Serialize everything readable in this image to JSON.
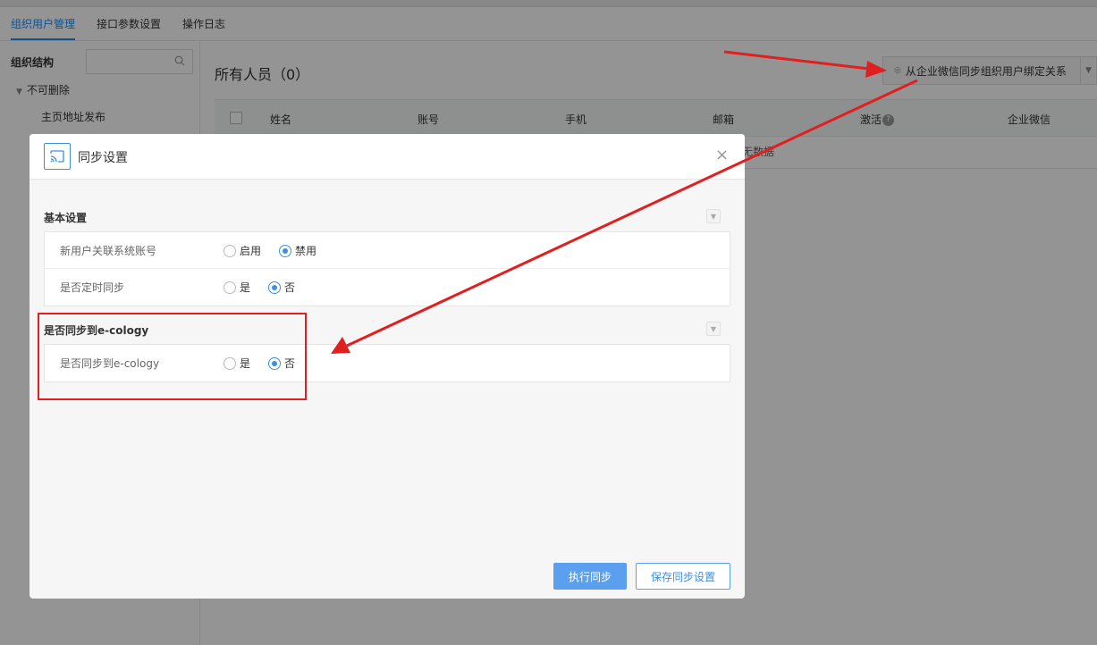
{
  "tabs": [
    {
      "label": "组织用户管理"
    },
    {
      "label": "接口参数设置"
    },
    {
      "label": "操作日志"
    }
  ],
  "sidebar": {
    "title": "组织结构",
    "search_placeholder": "",
    "root_node": "不可删除",
    "child_node": "主页地址发布"
  },
  "main": {
    "title": "所有人员（0）",
    "sync_button_label": "从企业微信同步组织用户绑定关系",
    "columns": [
      "姓名",
      "账号",
      "手机",
      "邮箱",
      "激活",
      "企业微信"
    ],
    "empty_text": "无数据"
  },
  "modal": {
    "title": "同步设置",
    "close_symbol": "×",
    "sections": [
      {
        "title": "基本设置",
        "rows": [
          {
            "label": "新用户关联系统账号",
            "options": [
              "启用",
              "禁用"
            ],
            "selected": 1
          },
          {
            "label": "是否定时同步",
            "options": [
              "是",
              "否"
            ],
            "selected": 1
          }
        ]
      },
      {
        "title": "是否同步到e-cology",
        "rows": [
          {
            "label": "是否同步到e-cology",
            "options": [
              "是",
              "否"
            ],
            "selected": 1
          }
        ]
      }
    ],
    "buttons": {
      "execute": "执行同步",
      "save": "保存同步设置"
    }
  },
  "colors": {
    "accent": "#3d8fe0",
    "primary_button": "#5aa0ef",
    "annotation": "#e02020"
  }
}
